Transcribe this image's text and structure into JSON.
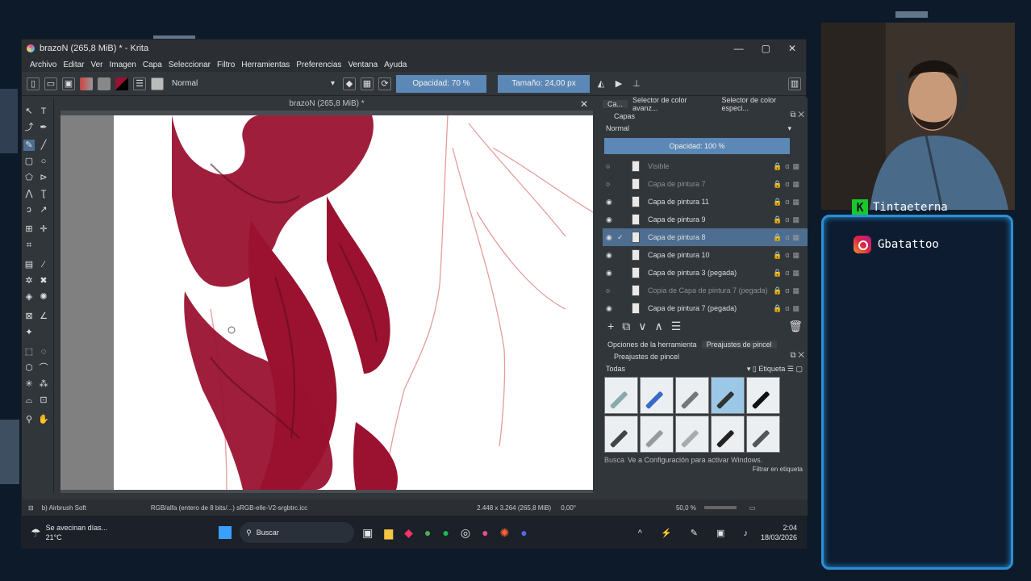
{
  "window": {
    "title": "brazoN (265,8 MiB) * - Krita",
    "controls": {
      "minimize": "—",
      "maximize": "▢",
      "close": "✕"
    }
  },
  "menu": [
    "Archivo",
    "Editar",
    "Ver",
    "Imagen",
    "Capa",
    "Seleccionar",
    "Filtro",
    "Herramientas",
    "Preferencias",
    "Ventana",
    "Ayuda"
  ],
  "toolbar": {
    "blend_mode": "Normal",
    "opacity_label": "Opacidad: 70 %",
    "size_label": "Tamaño: 24,00 px"
  },
  "document": {
    "tab_title": "brazoN (265,8 MiB) *",
    "close": "✕"
  },
  "dock": {
    "tabs": [
      "Ca...",
      "Selector de color avanz...",
      "Selector de color especi..."
    ],
    "layers_title": "Capas",
    "layers_mode": "Normal",
    "layers_opacity": "Opacidad:  100 %",
    "layers": [
      {
        "name": "Visible",
        "visible": false,
        "dim": true,
        "selected": false
      },
      {
        "name": "Capa de pintura 7",
        "visible": false,
        "dim": true,
        "selected": false
      },
      {
        "name": "Capa de pintura 11",
        "visible": true,
        "dim": false,
        "selected": false
      },
      {
        "name": "Capa de pintura 9",
        "visible": true,
        "dim": false,
        "selected": false
      },
      {
        "name": "Capa de pintura 8",
        "visible": true,
        "dim": false,
        "selected": true
      },
      {
        "name": "Capa de pintura 10",
        "visible": true,
        "dim": false,
        "selected": false
      },
      {
        "name": "Capa de pintura 3 (pegada)",
        "visible": true,
        "dim": false,
        "selected": false
      },
      {
        "name": "Copia de Capa de pintura 7 (pegada)",
        "visible": false,
        "dim": true,
        "selected": false
      },
      {
        "name": "Capa de pintura 7 (pegada)",
        "visible": true,
        "dim": false,
        "selected": false
      }
    ],
    "lower_tabs": [
      "Opciones de la herramienta",
      "Preajustes de pincel"
    ],
    "presets_title": "Preajustes de pincel",
    "presets_filter": "Todas",
    "presets_tag": "Etiqueta",
    "search_placeholder": "Busca",
    "activation_notice": "Ve a Configuración para activar Windows.",
    "filter_tag": "Filtrar en etiqueta"
  },
  "status": {
    "brush": "b) Airbrush Soft",
    "color_space": "RGB/alfa (entero de 8 bits/...)  sRGB-elle-V2-srgbtrc.icc",
    "image_size": "2.448 x 3.264 (265,8 MiB)",
    "rotation": "0,00°",
    "zoom": "50,0 %"
  },
  "taskbar": {
    "weather_text": "Se avecinan días...",
    "temperature": "21°C",
    "search": "Buscar",
    "time": "2:04",
    "date": "18/03/2026"
  },
  "overlay": {
    "streamer_name": "Tintaeterna",
    "instagram": "Gbatattoo",
    "badge": "K"
  },
  "colors": {
    "accent": "#5b88b6",
    "paint": "#9a1230",
    "frame": "#2a8fd6"
  }
}
